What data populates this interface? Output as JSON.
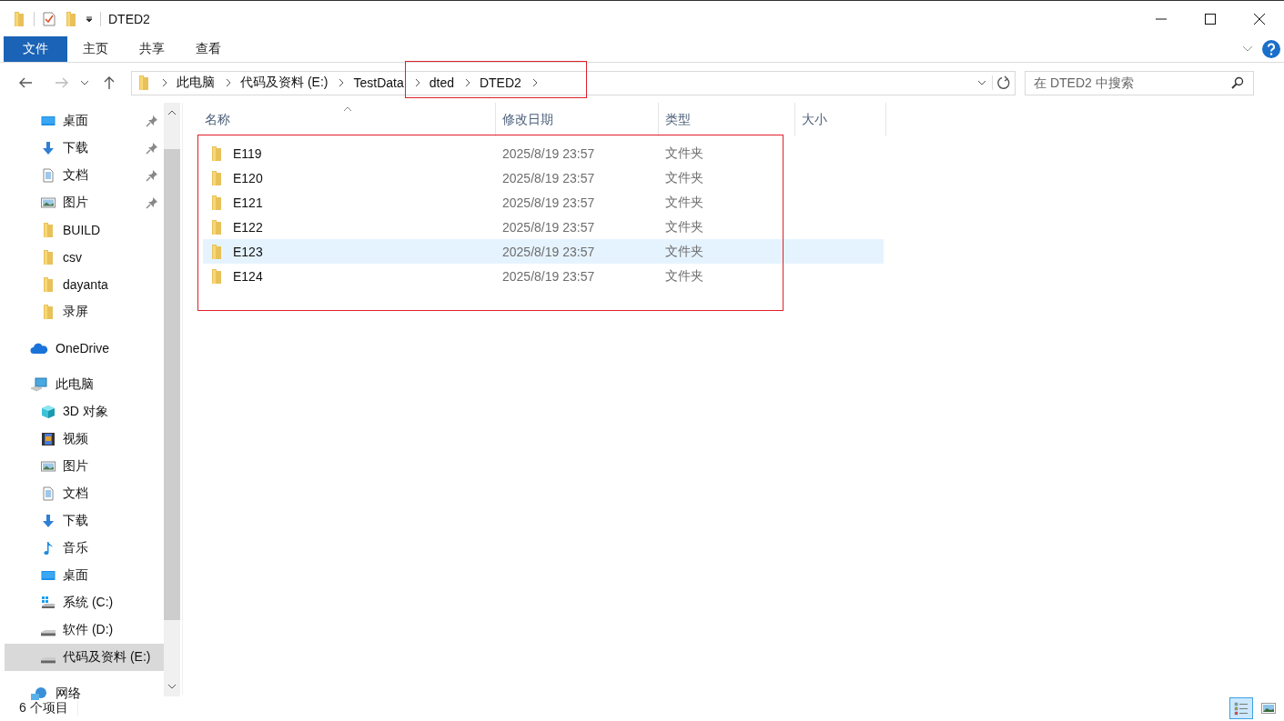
{
  "window": {
    "title": "DTED2"
  },
  "ribbon": {
    "tabs": [
      {
        "label": "文件",
        "kind": "file"
      },
      {
        "label": "主页",
        "kind": "tab"
      },
      {
        "label": "共享",
        "kind": "tab"
      },
      {
        "label": "查看",
        "kind": "tab"
      }
    ]
  },
  "address_bar": {
    "segments": [
      "此电脑",
      "代码及资料 (E:)",
      "TestData",
      "dted",
      "DTED2"
    ]
  },
  "search": {
    "placeholder": "在 DTED2 中搜索"
  },
  "sidebar": {
    "quick_access": [
      {
        "label": "桌面",
        "kind": "desktop",
        "pinned": true,
        "selected": false
      },
      {
        "label": "下载",
        "kind": "download",
        "pinned": true,
        "selected": false
      },
      {
        "label": "文档",
        "kind": "document",
        "pinned": true,
        "selected": false
      },
      {
        "label": "图片",
        "kind": "picture",
        "pinned": true,
        "selected": false
      },
      {
        "label": "BUILD",
        "kind": "folder",
        "pinned": false,
        "selected": false
      },
      {
        "label": "csv",
        "kind": "folder",
        "pinned": false,
        "selected": false
      },
      {
        "label": "dayanta",
        "kind": "folder",
        "pinned": false,
        "selected": false
      },
      {
        "label": "录屏",
        "kind": "folder",
        "pinned": false,
        "selected": false
      }
    ],
    "items": [
      {
        "label": "OneDrive",
        "kind": "onedrive",
        "selected": false
      },
      {
        "label": "此电脑",
        "kind": "pc",
        "selected": false,
        "children": [
          {
            "label": "3D 对象",
            "kind": "cube",
            "selected": false
          },
          {
            "label": "视频",
            "kind": "video",
            "selected": false
          },
          {
            "label": "图片",
            "kind": "picture",
            "selected": false
          },
          {
            "label": "文档",
            "kind": "document",
            "selected": false
          },
          {
            "label": "下载",
            "kind": "download",
            "selected": false
          },
          {
            "label": "音乐",
            "kind": "music",
            "selected": false
          },
          {
            "label": "桌面",
            "kind": "desktop",
            "selected": false
          },
          {
            "label": "系统 (C:)",
            "kind": "system-drive",
            "selected": false
          },
          {
            "label": "软件 (D:)",
            "kind": "drive",
            "selected": false
          },
          {
            "label": "代码及资料 (E:)",
            "kind": "drive",
            "selected": true
          }
        ]
      },
      {
        "label": "网络",
        "kind": "network",
        "selected": false
      }
    ]
  },
  "table": {
    "columns": [
      "名称",
      "修改日期",
      "类型",
      "大小"
    ],
    "rows": [
      {
        "name": "E119",
        "modified": "2025/8/19 23:57",
        "type": "文件夹",
        "selected": false
      },
      {
        "name": "E120",
        "modified": "2025/8/19 23:57",
        "type": "文件夹",
        "selected": false
      },
      {
        "name": "E121",
        "modified": "2025/8/19 23:57",
        "type": "文件夹",
        "selected": false
      },
      {
        "name": "E122",
        "modified": "2025/8/19 23:57",
        "type": "文件夹",
        "selected": false
      },
      {
        "name": "E123",
        "modified": "2025/8/19 23:57",
        "type": "文件夹",
        "selected": true
      },
      {
        "name": "E124",
        "modified": "2025/8/19 23:57",
        "type": "文件夹",
        "selected": false
      }
    ]
  },
  "status_bar": {
    "count": "6 个项目",
    "view_buttons": [
      {
        "kind": "details",
        "selected": true
      },
      {
        "kind": "icons",
        "selected": false
      }
    ]
  }
}
